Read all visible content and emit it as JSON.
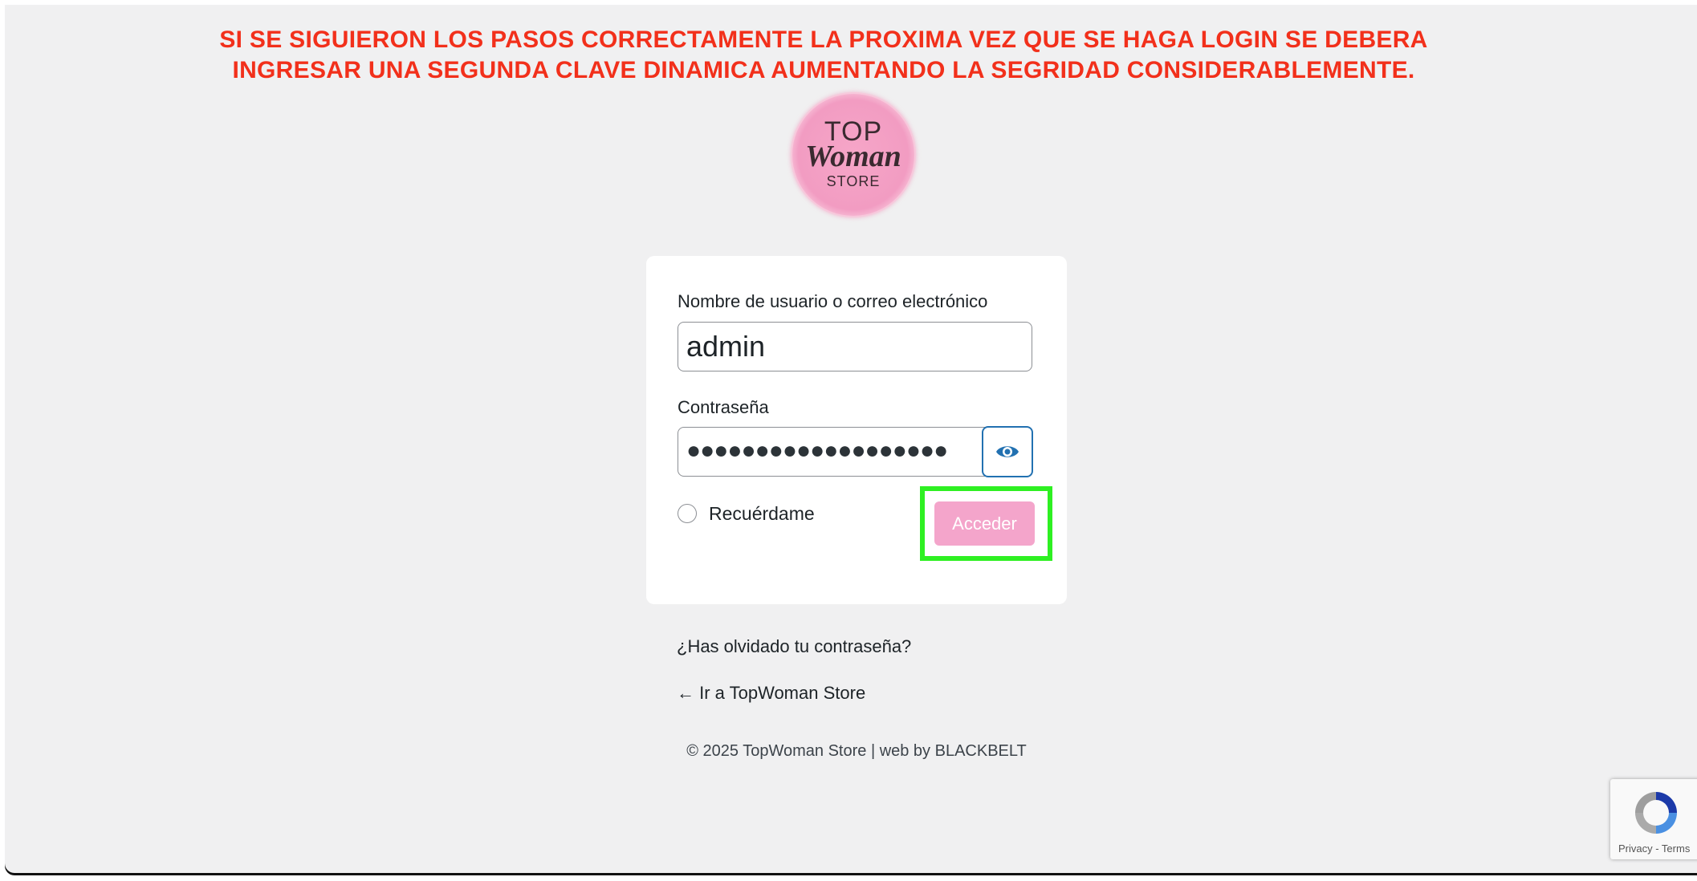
{
  "banner": {
    "line1": "SI SE SIGUIERON LOS PASOS CORRECTAMENTE LA PROXIMA VEZ QUE SE HAGA LOGIN SE DEBERA",
    "line2": "INGRESAR UNA SEGUNDA CLAVE DINAMICA AUMENTANDO LA SEGRIDAD CONSIDERABLEMENTE.",
    "color": "#f2301b"
  },
  "logo": {
    "line1": "TOP",
    "line2": "Woman",
    "line3": "STORE",
    "color": "#f29cc2"
  },
  "form": {
    "username_label": "Nombre de usuario o correo electrónico",
    "username_value": "admin",
    "password_label": "Contraseña",
    "password_mask": "●●●●●●●●●●●●●●●●●●●",
    "show_password_icon": "eye-icon",
    "remember_label": "Recuérdame",
    "remember_checked": false,
    "submit_label": "Acceder",
    "submit_color": "#f4a5cb",
    "highlight_color": "#2ef022"
  },
  "links": {
    "lost_password": "¿Has olvidado tu contraseña?",
    "back_to_site": "← Ir a TopWoman Store"
  },
  "footer": {
    "text": "© 2025 TopWoman Store | web by BLACKBELT"
  },
  "recaptcha": {
    "terms": "Privacy - Terms",
    "icon": "recaptcha-icon"
  }
}
